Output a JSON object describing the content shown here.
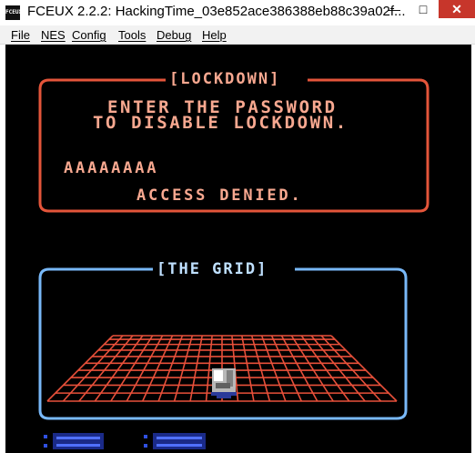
{
  "window": {
    "title": "FCEUX 2.2.2: HackingTime_03e852ace386388eb88c39a02f...",
    "icon": "fceux-app-icon",
    "min_glyph": "—",
    "max_glyph": "□",
    "close_glyph": "✕"
  },
  "menu": {
    "items": [
      "File",
      "NES",
      "Config",
      "Tools",
      "Debug",
      "Help"
    ]
  },
  "game": {
    "lockdown": {
      "title": "[LOCKDOWN]",
      "line1": "ENTER THE PASSWORD",
      "line2": "TO DISABLE LOCKDOWN.",
      "password": "AAAAAAAA",
      "status": "ACCESS DENIED."
    },
    "grid": {
      "title": "[THE GRID]"
    }
  },
  "colors": {
    "screen_bg": "#000000",
    "lockdown_frame": "#e4553a",
    "lockdown_text": "#f8a890",
    "grid_frame": "#78b8f8",
    "grid_title": "#bfe0ff",
    "grid_lines": "#e8503a",
    "close_button": "#c7362b"
  }
}
